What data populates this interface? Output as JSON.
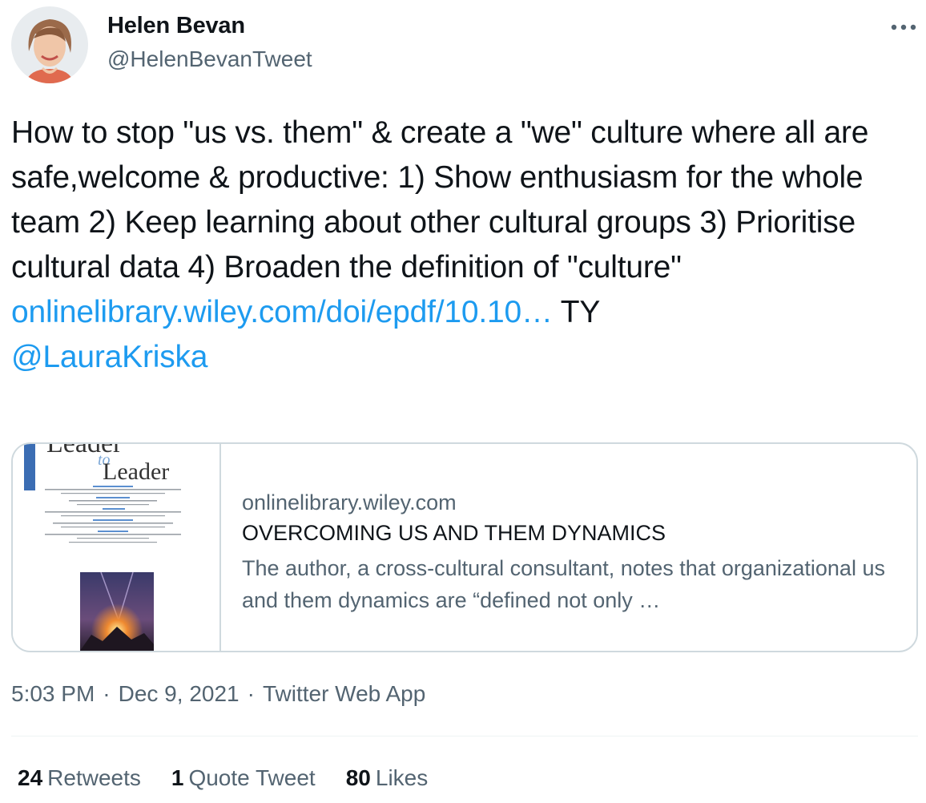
{
  "author": {
    "display_name": "Helen Bevan",
    "handle": "@HelenBevanTweet"
  },
  "tweet": {
    "text_before_link": "How to stop \"us vs. them\" & create a \"we\" culture where all are safe,welcome & productive: 1) Show enthusiasm for the whole team 2) Keep learning about other cultural groups 3) Prioritise cultural data 4) Broaden the definition of \"culture\"",
    "link_text": "onlinelibrary.wiley.com/doi/epdf/10.10…",
    "after_link": " TY",
    "mention": "@LauraKriska"
  },
  "card": {
    "domain": "onlinelibrary.wiley.com",
    "title": "OVERCOMING US AND THEM DYNAMICS",
    "description": "The author, a cross-cultural consultant, notes that organizational us and them dynamics are “defined not only …",
    "thumbnail": {
      "title_top": "Leader",
      "title_mid": "to",
      "title_bottom": "Leader"
    }
  },
  "meta": {
    "time": "5:03 PM",
    "separator": "·",
    "date": "Dec 9, 2021",
    "source": "Twitter Web App"
  },
  "stats": {
    "retweets_count": "24",
    "retweets_label": "Retweets",
    "quotes_count": "1",
    "quotes_label": "Quote Tweet",
    "likes_count": "80",
    "likes_label": "Likes"
  },
  "colors": {
    "link": "#1d9bf0",
    "primary_text": "#0f1419",
    "secondary_text": "#536471",
    "border": "#cfd9de"
  },
  "icons": {
    "more": "more-horizontal-icon",
    "avatar": "profile-photo"
  }
}
